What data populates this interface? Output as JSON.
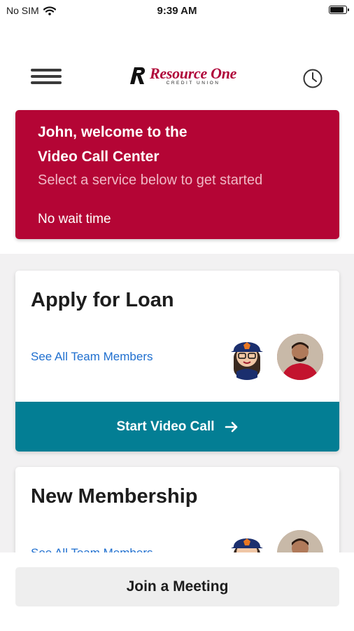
{
  "status_bar": {
    "carrier": "No SIM",
    "time": "9:39 AM",
    "battery_level": 0.9
  },
  "header": {
    "logo_name": "Resource One",
    "logo_sub": "CREDIT UNION",
    "menu_icon": "hamburger-menu-icon",
    "history_icon": "clock-icon"
  },
  "banner": {
    "title_line1": "John, welcome to the",
    "title_line2": "Video Call Center",
    "subtitle": "Select a service below to get started",
    "wait": "No wait time",
    "color": "#b40535"
  },
  "services": [
    {
      "title": "Apply for Loan",
      "link": "See All Team Members",
      "button": "Start Video Call"
    },
    {
      "title": "New Membership",
      "link": "See All Team Members"
    }
  ],
  "footer": {
    "join_label": "Join a Meeting"
  },
  "colors": {
    "accent": "#037e94",
    "brand": "#b40535",
    "link": "#1f6fcf"
  }
}
